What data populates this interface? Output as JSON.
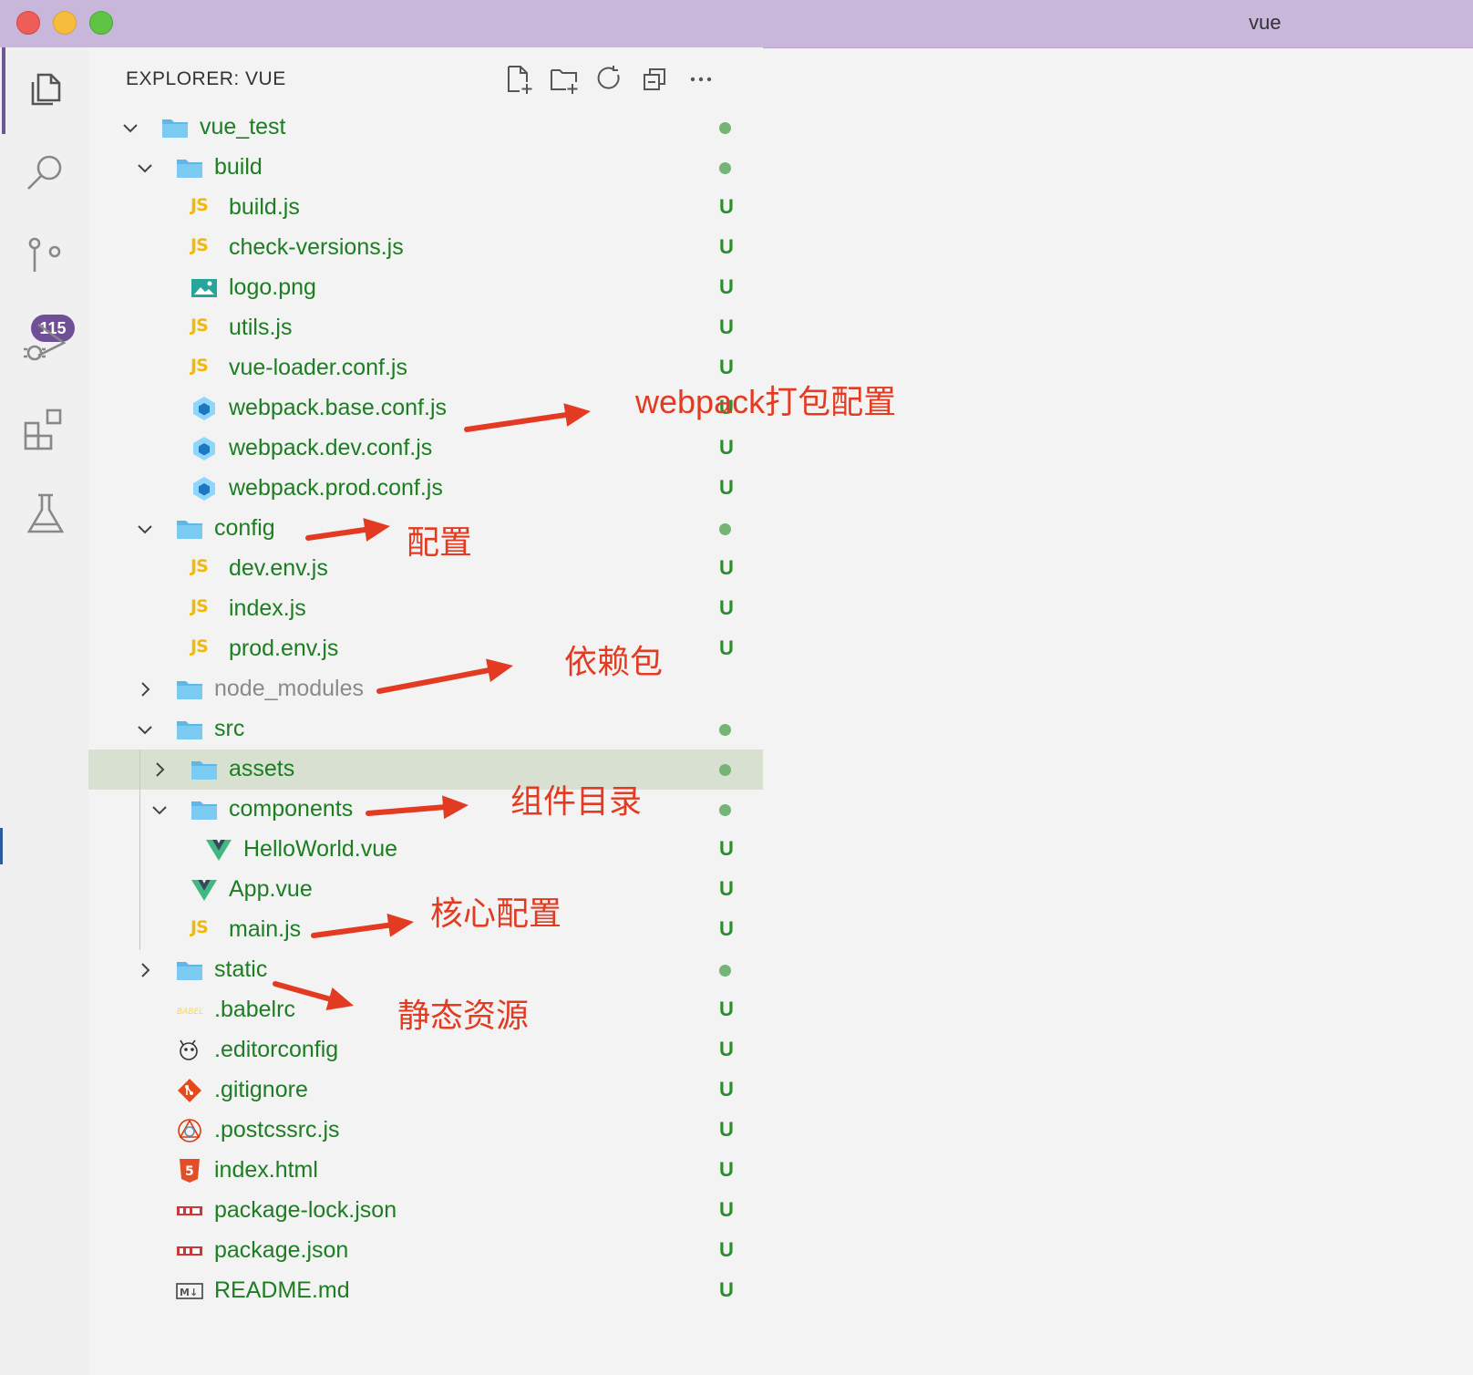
{
  "window": {
    "title": "vue"
  },
  "activity_bar": {
    "items": [
      {
        "name": "explorer-icon",
        "active": true
      },
      {
        "name": "search-icon"
      },
      {
        "name": "source-control-icon",
        "badge": "115"
      },
      {
        "name": "run-debug-icon"
      },
      {
        "name": "extensions-icon"
      },
      {
        "name": "testing-icon"
      }
    ]
  },
  "explorer": {
    "title": "EXPLORER: VUE",
    "toolbar": [
      "new-file-icon",
      "new-folder-icon",
      "refresh-icon",
      "collapse-all-icon",
      "more-icon"
    ],
    "tree": [
      {
        "label": "vue_test",
        "type": "folder",
        "depth": 0,
        "expanded": true,
        "status": "dot"
      },
      {
        "label": "build",
        "type": "folder",
        "depth": 1,
        "expanded": true,
        "status": "dot"
      },
      {
        "label": "build.js",
        "type": "js",
        "depth": 2,
        "status": "U"
      },
      {
        "label": "check-versions.js",
        "type": "js",
        "depth": 2,
        "status": "U"
      },
      {
        "label": "logo.png",
        "type": "image",
        "depth": 2,
        "status": "U"
      },
      {
        "label": "utils.js",
        "type": "js",
        "depth": 2,
        "status": "U"
      },
      {
        "label": "vue-loader.conf.js",
        "type": "js",
        "depth": 2,
        "status": "U"
      },
      {
        "label": "webpack.base.conf.js",
        "type": "webpack",
        "depth": 2,
        "status": "U"
      },
      {
        "label": "webpack.dev.conf.js",
        "type": "webpack",
        "depth": 2,
        "status": "U"
      },
      {
        "label": "webpack.prod.conf.js",
        "type": "webpack",
        "depth": 2,
        "status": "U"
      },
      {
        "label": "config",
        "type": "folder",
        "depth": 1,
        "expanded": true,
        "status": "dot"
      },
      {
        "label": "dev.env.js",
        "type": "js",
        "depth": 2,
        "status": "U"
      },
      {
        "label": "index.js",
        "type": "js",
        "depth": 2,
        "status": "U"
      },
      {
        "label": "prod.env.js",
        "type": "js",
        "depth": 2,
        "status": "U"
      },
      {
        "label": "node_modules",
        "type": "folder",
        "depth": 1,
        "expanded": false,
        "status": "",
        "ignored": true
      },
      {
        "label": "src",
        "type": "folder",
        "depth": 1,
        "expanded": true,
        "status": "dot"
      },
      {
        "label": "assets",
        "type": "folder",
        "depth": 2,
        "expanded": false,
        "status": "dot",
        "selected": true
      },
      {
        "label": "components",
        "type": "folder",
        "depth": 2,
        "expanded": true,
        "status": "dot"
      },
      {
        "label": "HelloWorld.vue",
        "type": "vue",
        "depth": 3,
        "status": "U"
      },
      {
        "label": "App.vue",
        "type": "vue",
        "depth": 2,
        "status": "U"
      },
      {
        "label": "main.js",
        "type": "js",
        "depth": 2,
        "status": "U"
      },
      {
        "label": "static",
        "type": "folder",
        "depth": 1,
        "expanded": false,
        "status": "dot"
      },
      {
        "label": ".babelrc",
        "type": "babel",
        "depth": 1,
        "status": "U"
      },
      {
        "label": ".editorconfig",
        "type": "editorconfig",
        "depth": 1,
        "status": "U"
      },
      {
        "label": ".gitignore",
        "type": "git",
        "depth": 1,
        "status": "U"
      },
      {
        "label": ".postcssrc.js",
        "type": "postcss",
        "depth": 1,
        "status": "U"
      },
      {
        "label": "index.html",
        "type": "html",
        "depth": 1,
        "status": "U"
      },
      {
        "label": "package-lock.json",
        "type": "npm",
        "depth": 1,
        "status": "U"
      },
      {
        "label": "package.json",
        "type": "npm",
        "depth": 1,
        "status": "U"
      },
      {
        "label": "README.md",
        "type": "markdown",
        "depth": 1,
        "status": "U"
      }
    ]
  },
  "annotations": [
    {
      "text": "webpack打包配置",
      "target": "webpack.base.conf.js"
    },
    {
      "text": "配置",
      "target": "config"
    },
    {
      "text": "依赖包",
      "target": "node_modules"
    },
    {
      "text": "组件目录",
      "target": "components"
    },
    {
      "text": "核心配置",
      "target": "main.js"
    },
    {
      "text": "静态资源",
      "target": "static"
    }
  ],
  "colors": {
    "titlebar": "#c9b6db",
    "tree_text": "#1d7d22",
    "status_u": "#2a8f2a",
    "annotation": "#e33b21",
    "selection": "#d7e0d1"
  }
}
